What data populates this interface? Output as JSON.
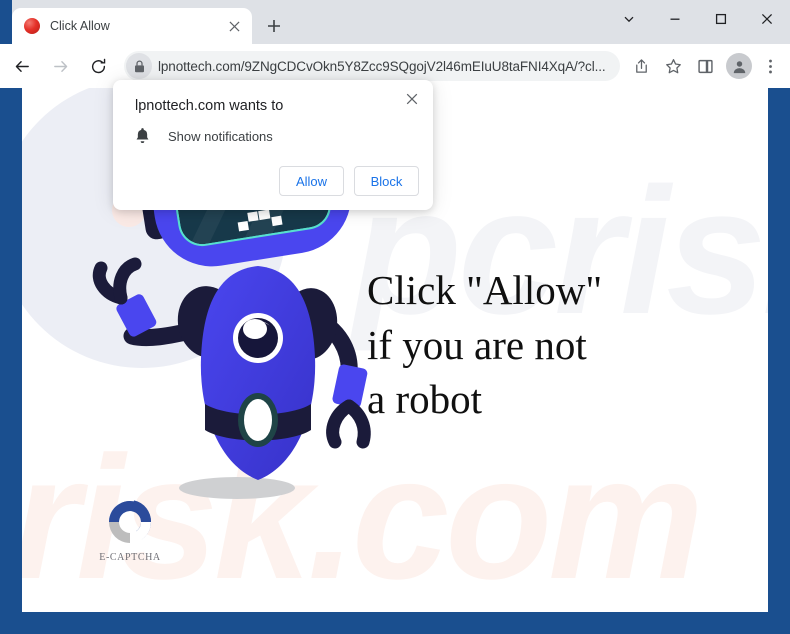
{
  "window": {
    "controls": [
      {
        "name": "tab-search-button",
        "icon": "chevron-down-icon",
        "label": "∨"
      },
      {
        "name": "minimize-button",
        "icon": "minimize-icon",
        "label": "—"
      },
      {
        "name": "maximize-button",
        "icon": "maximize-icon",
        "label": "□"
      },
      {
        "name": "close-button",
        "icon": "close-icon",
        "label": "✕"
      }
    ]
  },
  "tab": {
    "title": "Click Allow",
    "favicon": "red-sphere-favicon",
    "close_icon": "close-icon",
    "new_tab_icon": "plus-icon"
  },
  "toolbar": {
    "back_icon": "back-arrow-icon",
    "forward_icon": "forward-arrow-icon",
    "reload_icon": "reload-icon",
    "lock_icon": "lock-icon",
    "url": "lpnottech.com/9ZNgCDCvOkn5Y8Zcc9SQgojV2l46mEIuU8taFNI4XqA/?cl...",
    "share_icon": "share-icon",
    "bookmark_icon": "star-icon",
    "side_panel_icon": "side-panel-icon",
    "profile_icon": "profile-avatar-icon",
    "menu_icon": "three-dot-menu-icon"
  },
  "permission_dialog": {
    "title": "lpnottech.com wants to",
    "option_icon": "bell-icon",
    "option_label": "Show notifications",
    "close_icon": "close-icon",
    "allow_label": "Allow",
    "block_label": "Block"
  },
  "page": {
    "headline_line1": "Click \"Allow\"",
    "headline_line2": "if you are not",
    "headline_line3": "a robot",
    "watermark_top": "pcrisk",
    "watermark_bottom": "risk.com",
    "logo_label": "E-CAPTCHA",
    "logo_mark": "c-arc-logo",
    "mascot": "blue-robot-mascot"
  },
  "colors": {
    "accent_blue": "#1a73e8",
    "robot_body": "#3f44e0",
    "robot_dark": "#1b1b3a",
    "screen_teal": "#4fd6c8",
    "logo_dark_blue": "#2b4b9b",
    "logo_light_blue": "#5f93e0",
    "logo_gray": "#bdbdbd",
    "tabstrip_bg": "#dee1e6",
    "frame_blue": "#1a4f8f"
  }
}
